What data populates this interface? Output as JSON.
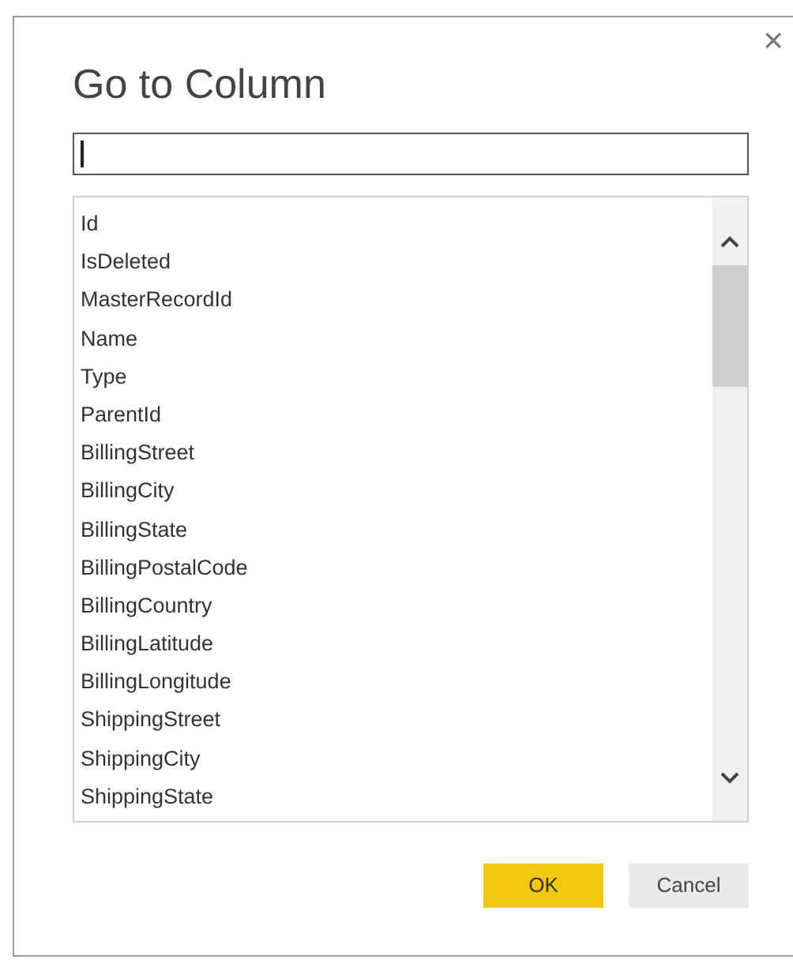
{
  "dialog": {
    "title": "Go to Column",
    "close": "×"
  },
  "filter_field": {
    "focused": true
  },
  "columns": [
    {
      "label": "Id"
    },
    {
      "label": "IsDeleted"
    },
    {
      "label": "MasterRecordId"
    },
    {
      "label": "Name"
    },
    {
      "label": "Type"
    },
    {
      "label": "ParentId"
    },
    {
      "label": "BillingStreet"
    },
    {
      "label": "BillingCity"
    },
    {
      "label": "BillingState"
    },
    {
      "label": "BillingPostalCode"
    },
    {
      "label": "BillingCountry"
    },
    {
      "label": "BillingLatitude"
    },
    {
      "label": "BillingLongitude"
    },
    {
      "label": "ShippingStreet"
    },
    {
      "label": "ShippingCity"
    },
    {
      "label": "ShippingState"
    }
  ],
  "buttons": [
    {
      "label": "OK",
      "kind": "primary"
    },
    {
      "label": "Cancel",
      "kind": "secondary"
    }
  ]
}
